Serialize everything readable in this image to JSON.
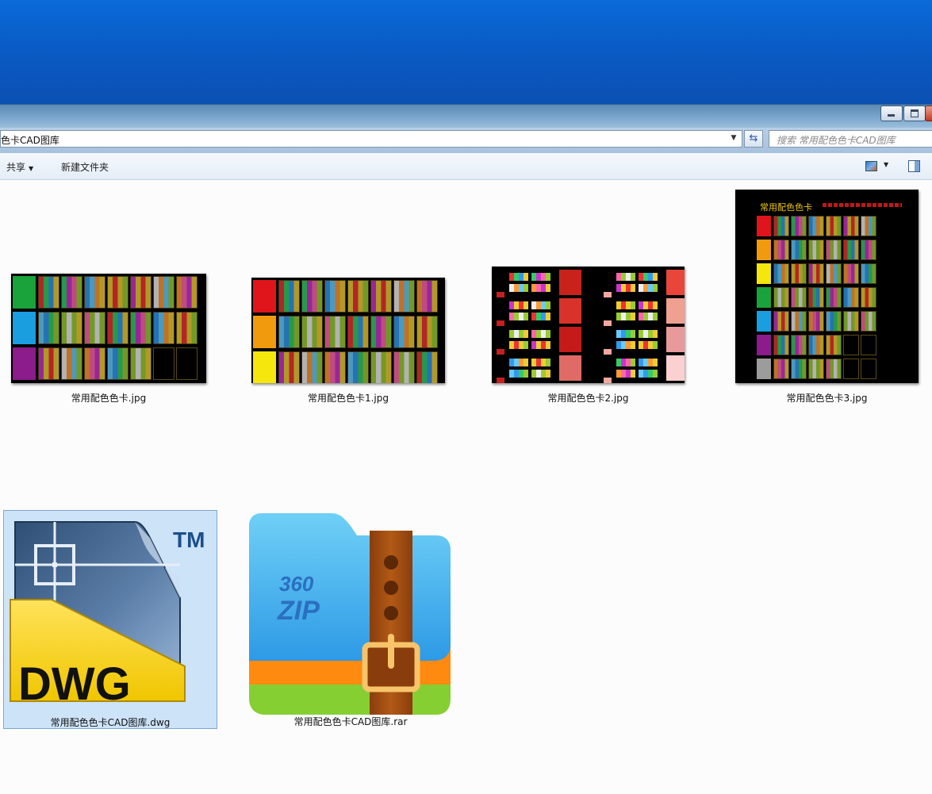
{
  "window": {
    "address": "色卡CAD图库",
    "search_placeholder": "搜索 常用配色色卡CAD图库"
  },
  "toolbar": {
    "share_label": "共享",
    "new_folder_label": "新建文件夹"
  },
  "files": [
    {
      "name": "常用配色色卡.jpg",
      "type": "image"
    },
    {
      "name": "常用配色色卡1.jpg",
      "type": "image"
    },
    {
      "name": "常用配色色卡2.jpg",
      "type": "image"
    },
    {
      "name": "常用配色色卡3.jpg",
      "type": "image"
    },
    {
      "name": "常用配色色卡CAD图库.dwg",
      "type": "dwg",
      "selected": true
    },
    {
      "name": "常用配色色卡CAD图库.rar",
      "type": "rar"
    }
  ],
  "thumb3": {
    "title": "常用配色色卡"
  },
  "dwg_icon": {
    "text": "DWG",
    "tm": "TM"
  },
  "zip_icon": {
    "line1": "360",
    "line2": "ZIP"
  },
  "colors": {
    "desktop": "#0a5cc6",
    "selection": "#cde3f8",
    "swatches": [
      "#19a33a",
      "#1a9ee0",
      "#8c1b8c",
      "#e0141b",
      "#f29a0e",
      "#f5e60d",
      "#9c9c9c",
      "#d8322a"
    ]
  }
}
